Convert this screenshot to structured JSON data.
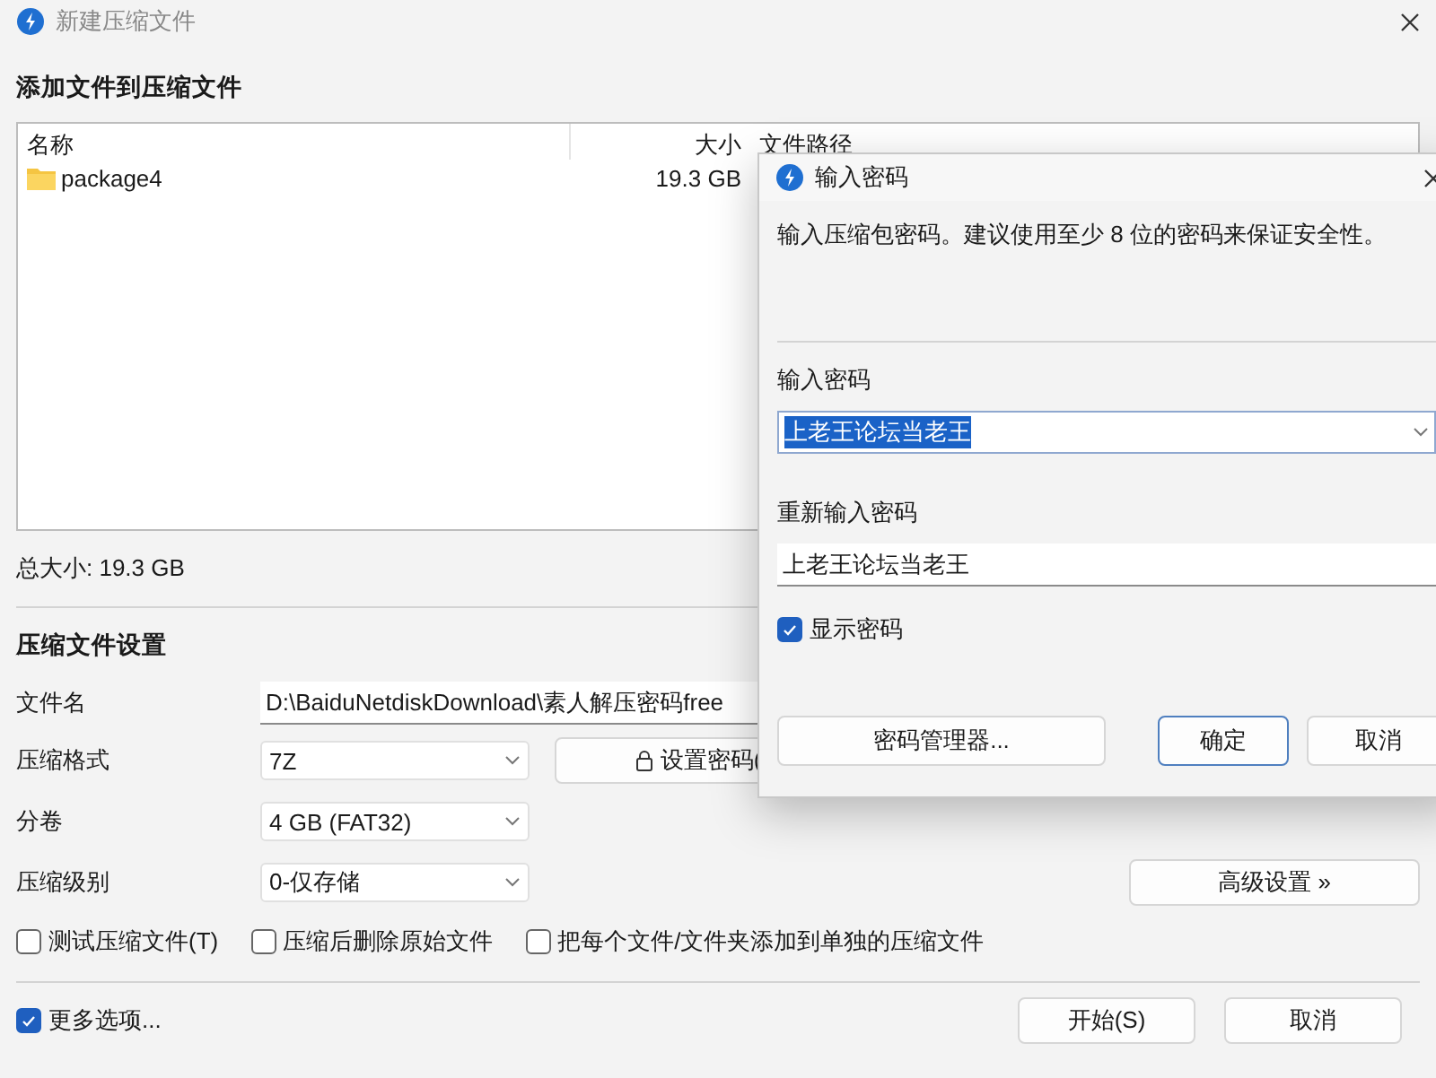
{
  "window": {
    "title": "新建压缩文件"
  },
  "files_section": {
    "heading": "添加文件到压缩文件",
    "columns": [
      "名称",
      "大小",
      "文件路径"
    ],
    "rows": [
      {
        "name": "package4",
        "size": "19.3 GB"
      }
    ],
    "total": "总大小: 19.3 GB"
  },
  "settings": {
    "heading": "压缩文件设置",
    "file_name": {
      "label": "文件名",
      "value": "D:\\BaiduNetdiskDownload\\素人解压密码free"
    },
    "format": {
      "label": "压缩格式",
      "value": "7Z"
    },
    "set_password_button": "设置密码(",
    "volume": {
      "label": "分卷",
      "value": "4 GB (FAT32)"
    },
    "level": {
      "label": "压缩级别",
      "value": "0-仅存储"
    },
    "advanced_button": "高级设置 »",
    "options": [
      {
        "label": "测试压缩文件(T)",
        "checked": false
      },
      {
        "label": "压缩后删除原始文件",
        "checked": false
      },
      {
        "label": "把每个文件/文件夹添加到单独的压缩文件",
        "checked": false
      }
    ]
  },
  "footer": {
    "more_options": {
      "label": "更多选项...",
      "checked": true
    },
    "buttons": [
      "开始(S)",
      "取消"
    ]
  },
  "password_dialog": {
    "title": "输入密码",
    "description": "输入压缩包密码。建议使用至少 8 位的密码来保证安全性。",
    "password": {
      "label": "输入密码",
      "value": "上老王论坛当老王",
      "selected": true
    },
    "confirm": {
      "label": "重新输入密码",
      "value": "上老王论坛当老王"
    },
    "show_password": {
      "label": "显示密码",
      "checked": true
    },
    "buttons": [
      {
        "label": "密码管理器...",
        "default": false
      },
      {
        "label": "确定",
        "default": true
      },
      {
        "label": "取消",
        "default": false
      }
    ]
  }
}
